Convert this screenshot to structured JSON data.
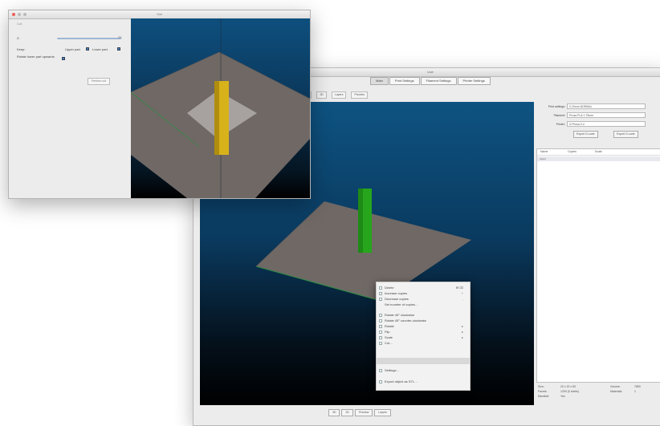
{
  "main_window": {
    "title": "Live",
    "tabs": [
      {
        "label": "Main",
        "active": true
      },
      {
        "label": "Print Settings",
        "active": false
      },
      {
        "label": "Filament Settings",
        "active": false
      },
      {
        "label": "Printer Settings",
        "active": false
      }
    ],
    "toolbar": [
      "3D",
      "2D",
      "Layers",
      "Preview"
    ],
    "context_menu": {
      "items": [
        {
          "label": "Delete",
          "shortcut": "⌘⌫",
          "check": true
        },
        {
          "label": "Increase copies",
          "shortcut": "+",
          "check": true
        },
        {
          "label": "Decrease copies",
          "shortcut": "-",
          "check": true
        },
        {
          "label": "Set number of copies…",
          "shortcut": "",
          "check": false
        },
        {
          "label": "Rotate 45° clockwise",
          "shortcut": "",
          "check": true
        },
        {
          "label": "Rotate 45° counter-clockwise",
          "shortcut": "",
          "check": true
        },
        {
          "label": "Rotate",
          "shortcut": "▸",
          "check": true
        },
        {
          "label": "Flip",
          "shortcut": "▸",
          "check": true
        },
        {
          "label": "Scale",
          "shortcut": "▸",
          "check": true
        },
        {
          "label": "Cut…",
          "shortcut": "",
          "check": true
        },
        {
          "label": "Settings…",
          "shortcut": "",
          "check": true
        },
        {
          "label": "Export object as STL…",
          "shortcut": "",
          "check": true
        }
      ]
    },
    "bottom_controls": [
      "3D",
      "2D",
      "Preview",
      "Layers"
    ],
    "right_panel": {
      "rows": [
        {
          "label": "Print settings:",
          "value": "0.20mm NORMAL"
        },
        {
          "label": "Filament:",
          "value": "Prusa PLA 1.75mm"
        },
        {
          "label": "Printer:",
          "value": "i3 Prusa 0.4"
        }
      ],
      "buttons": [
        "Export G-code",
        "Export G-code"
      ],
      "table_headers": [
        "Name",
        "Copies",
        "Scale"
      ],
      "table_rows": [
        "object"
      ],
      "info": [
        {
          "k": "Size:",
          "v": "20 x 20 x 50",
          "k2": "Volume:",
          "v2": "7850"
        },
        {
          "k": "Facets:",
          "v": "1200 (0 shells)",
          "k2": "Materials:",
          "v2": "1"
        },
        {
          "k": "Manifold:",
          "v": "Yes",
          "k2": "",
          "v2": ""
        }
      ]
    }
  },
  "small_window": {
    "title": "Cut",
    "labels": {
      "heading": "Cut",
      "z_label": "Z:",
      "z_value": "25",
      "keep": "Keep:",
      "upper_part": "Upper part",
      "lower_part": "Lower part",
      "rotate": "Rotate lower part upwards",
      "cut_button": "Perform cut"
    }
  },
  "colors": {
    "plate": "#6f6865",
    "object_green": "#27a51d",
    "object_yellow": "#d8b21a",
    "sky_top": "#0e5382"
  }
}
